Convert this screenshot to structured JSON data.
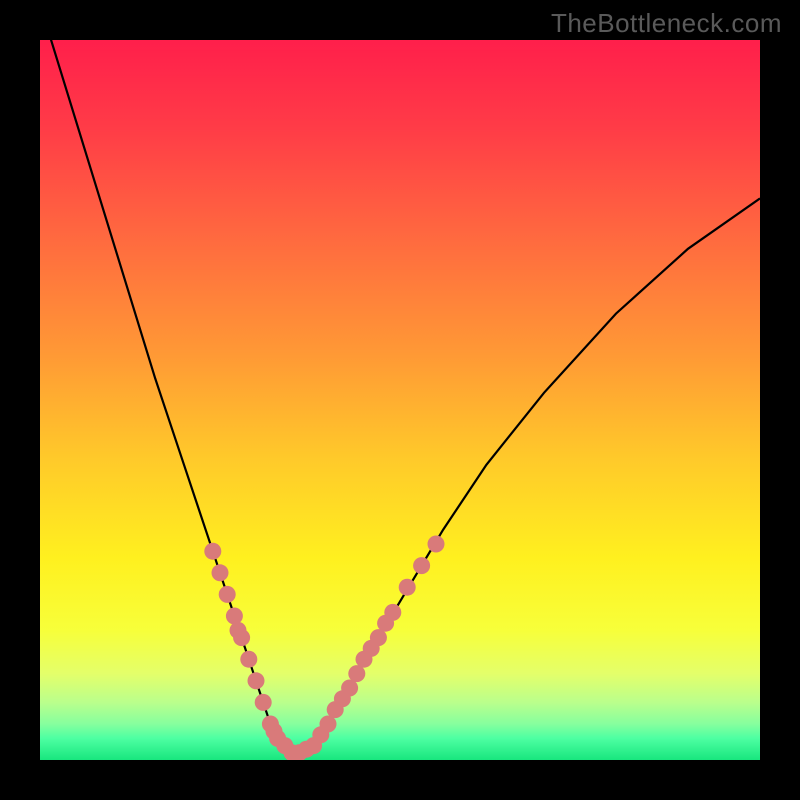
{
  "watermark": "TheBottleneck.com",
  "chart_data": {
    "type": "line",
    "title": "",
    "xlabel": "",
    "ylabel": "",
    "xlim": [
      0,
      100
    ],
    "ylim": [
      0,
      100
    ],
    "x": [
      0,
      4,
      8,
      12,
      16,
      20,
      22,
      24,
      26,
      28,
      29,
      30,
      31,
      32,
      33,
      34,
      35,
      36,
      38,
      40,
      44,
      50,
      56,
      62,
      70,
      80,
      90,
      100
    ],
    "series": [
      {
        "name": "bottleneck-curve",
        "values": [
          105,
          92,
          79,
          66,
          53,
          41,
          35,
          29,
          23,
          17,
          14,
          11,
          8,
          5,
          3,
          2,
          1,
          1,
          2,
          5,
          12,
          22,
          32,
          41,
          51,
          62,
          71,
          78
        ]
      }
    ],
    "markers": [
      {
        "x": 24,
        "y": 29
      },
      {
        "x": 25,
        "y": 26
      },
      {
        "x": 26,
        "y": 23
      },
      {
        "x": 27,
        "y": 20
      },
      {
        "x": 27.5,
        "y": 18
      },
      {
        "x": 28,
        "y": 17
      },
      {
        "x": 29,
        "y": 14
      },
      {
        "x": 30,
        "y": 11
      },
      {
        "x": 31,
        "y": 8
      },
      {
        "x": 32,
        "y": 5
      },
      {
        "x": 32.5,
        "y": 4
      },
      {
        "x": 33,
        "y": 3
      },
      {
        "x": 34,
        "y": 2
      },
      {
        "x": 35,
        "y": 1
      },
      {
        "x": 36,
        "y": 1
      },
      {
        "x": 37,
        "y": 1.5
      },
      {
        "x": 38,
        "y": 2
      },
      {
        "x": 39,
        "y": 3.5
      },
      {
        "x": 40,
        "y": 5
      },
      {
        "x": 41,
        "y": 7
      },
      {
        "x": 42,
        "y": 8.5
      },
      {
        "x": 43,
        "y": 10
      },
      {
        "x": 44,
        "y": 12
      },
      {
        "x": 45,
        "y": 14
      },
      {
        "x": 46,
        "y": 15.5
      },
      {
        "x": 47,
        "y": 17
      },
      {
        "x": 48,
        "y": 19
      },
      {
        "x": 49,
        "y": 20.5
      },
      {
        "x": 51,
        "y": 24
      },
      {
        "x": 53,
        "y": 27
      },
      {
        "x": 55,
        "y": 30
      }
    ],
    "gradient_stops": [
      {
        "pct": 0,
        "color": "#ff1f4b"
      },
      {
        "pct": 12,
        "color": "#ff3b47"
      },
      {
        "pct": 28,
        "color": "#ff6b3f"
      },
      {
        "pct": 44,
        "color": "#ff9a35"
      },
      {
        "pct": 58,
        "color": "#ffc92a"
      },
      {
        "pct": 72,
        "color": "#fff01f"
      },
      {
        "pct": 82,
        "color": "#f7ff3a"
      },
      {
        "pct": 88,
        "color": "#e4ff6a"
      },
      {
        "pct": 92,
        "color": "#baff8c"
      },
      {
        "pct": 95,
        "color": "#86ff9e"
      },
      {
        "pct": 97,
        "color": "#4dffa2"
      },
      {
        "pct": 100,
        "color": "#18e67e"
      }
    ],
    "marker_color": "#d97a7a",
    "curve_color": "#000000"
  }
}
